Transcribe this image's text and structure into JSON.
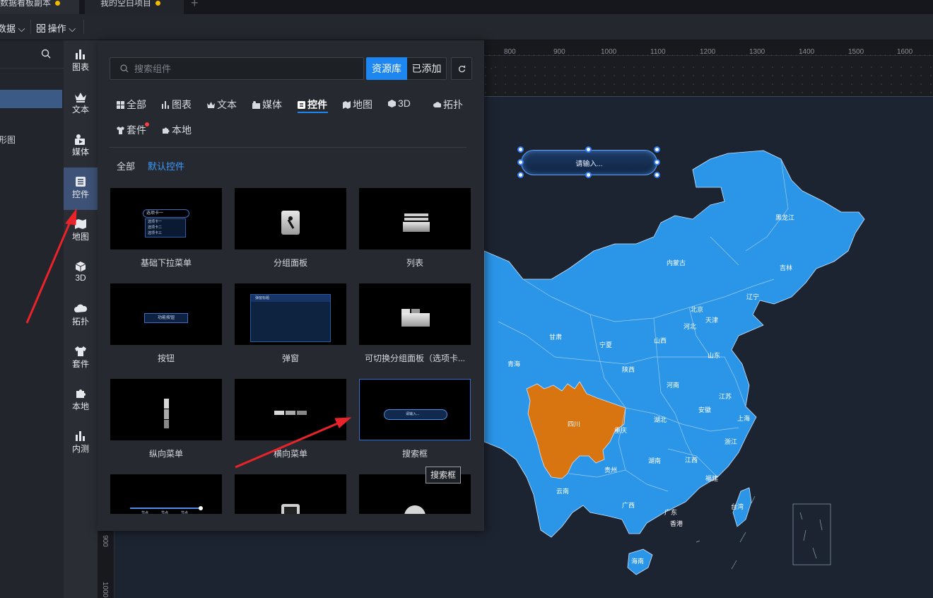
{
  "tabs": [
    {
      "label": "数据看板副本"
    },
    {
      "label": "我的空白项目"
    }
  ],
  "toolbar": {
    "data_label": "数据",
    "ops_label": "操作"
  },
  "left_panel": {
    "item_label": "形图"
  },
  "rail": [
    {
      "label": "图表"
    },
    {
      "label": "文本"
    },
    {
      "label": "媒体"
    },
    {
      "label": "控件"
    },
    {
      "label": "地图"
    },
    {
      "label": "3D"
    },
    {
      "label": "拓扑"
    },
    {
      "label": "套件"
    },
    {
      "label": "本地"
    },
    {
      "label": "内测"
    }
  ],
  "popup": {
    "search_placeholder": "搜索组件",
    "btn_library": "资源库",
    "btn_added": "已添加",
    "categories": [
      "全部",
      "图表",
      "文本",
      "媒体",
      "控件",
      "地图",
      "3D",
      "拓扑",
      "套件",
      "本地"
    ],
    "sub_all": "全部",
    "sub_default": "默认控件",
    "cards": [
      {
        "label": "基础下拉菜单"
      },
      {
        "label": "分组面板"
      },
      {
        "label": "列表"
      },
      {
        "label": "按钮"
      },
      {
        "label": "弹窗"
      },
      {
        "label": "可切换分组面板（选项卡..."
      },
      {
        "label": "纵向菜单"
      },
      {
        "label": "横向菜单"
      },
      {
        "label": "搜索框"
      }
    ],
    "thumb_text": {
      "dropdown_head": "选项卡一",
      "dropdown_items": [
        "选项卡一",
        "选项卡二",
        "选项卡三"
      ],
      "button_text": "功能按钮",
      "dialog_title": "弹窗标题",
      "search_text": "请输入...",
      "slider_ticks": [
        "节点",
        "节点",
        "节点"
      ]
    },
    "tooltip": "搜索框"
  },
  "canvas": {
    "widget_text": "请输入...",
    "ruler_top": [
      "800",
      "900",
      "1000",
      "1100",
      "1200",
      "1300",
      "1400",
      "1500",
      "1600"
    ],
    "ruler_left": [
      "900",
      "1000"
    ]
  },
  "map": {
    "colors": {
      "province": "#2b95e8",
      "highlight": "#d97510",
      "border": "#c9e4ff"
    },
    "labels": [
      "黑龙江",
      "吉林",
      "辽宁",
      "内蒙古",
      "北京",
      "天津",
      "河北",
      "山西",
      "山东",
      "甘肃",
      "宁夏",
      "青海",
      "陕西",
      "河南",
      "江苏",
      "安徽",
      "上海",
      "湖北",
      "四川",
      "重庆",
      "浙江",
      "贵州",
      "湖南",
      "江西",
      "福建",
      "云南",
      "广西",
      "广东",
      "台湾",
      "香港",
      "海南"
    ]
  }
}
